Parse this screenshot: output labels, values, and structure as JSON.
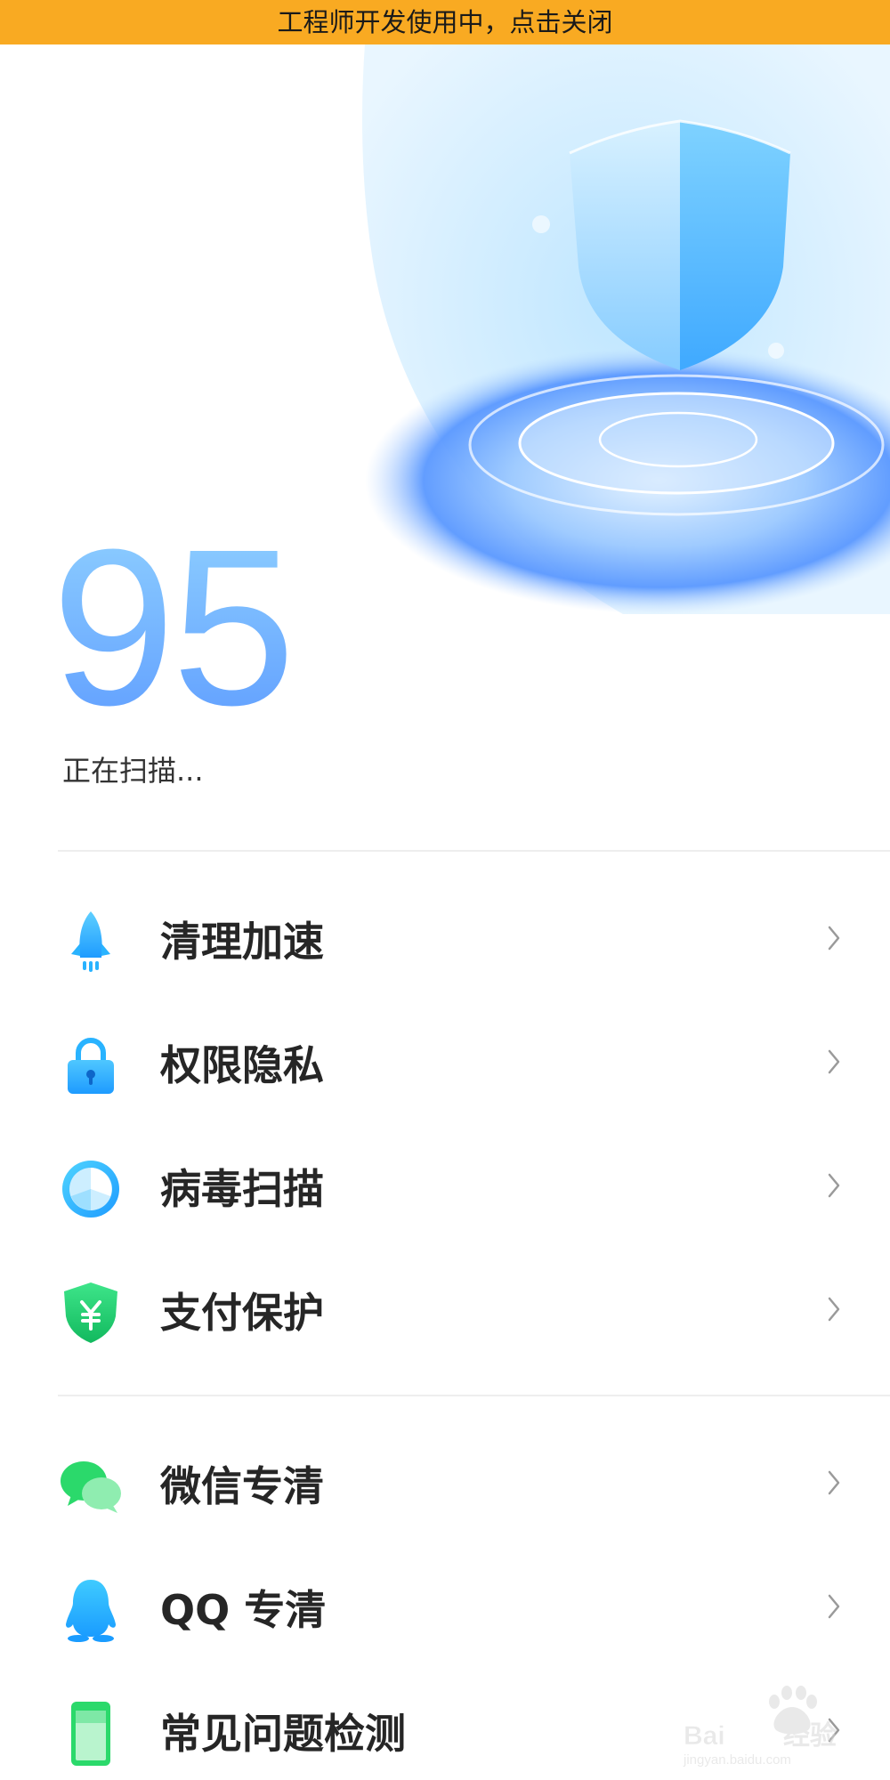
{
  "banner": {
    "text": "工程师开发使用中，点击关闭"
  },
  "hero": {
    "score": "95",
    "status": "正在扫描..."
  },
  "menu": {
    "group1": [
      {
        "label": "清理加速",
        "icon": "rocket-icon"
      },
      {
        "label": "权限隐私",
        "icon": "lock-icon"
      },
      {
        "label": "病毒扫描",
        "icon": "virus-scan-icon"
      },
      {
        "label": "支付保护",
        "icon": "payment-shield-icon"
      }
    ],
    "group2": [
      {
        "label": "微信专清",
        "icon": "wechat-icon"
      },
      {
        "label": "QQ 专清",
        "icon": "qq-penguin-icon"
      },
      {
        "label": "常见问题检测",
        "icon": "phone-check-icon"
      }
    ]
  },
  "watermark": {
    "text": "Bai du 经验",
    "subtext": "jingyan.baidu.com"
  },
  "colors": {
    "banner": "#F9AA22",
    "accent_blue": "#5F9DFF",
    "green": "#2BD96B"
  }
}
